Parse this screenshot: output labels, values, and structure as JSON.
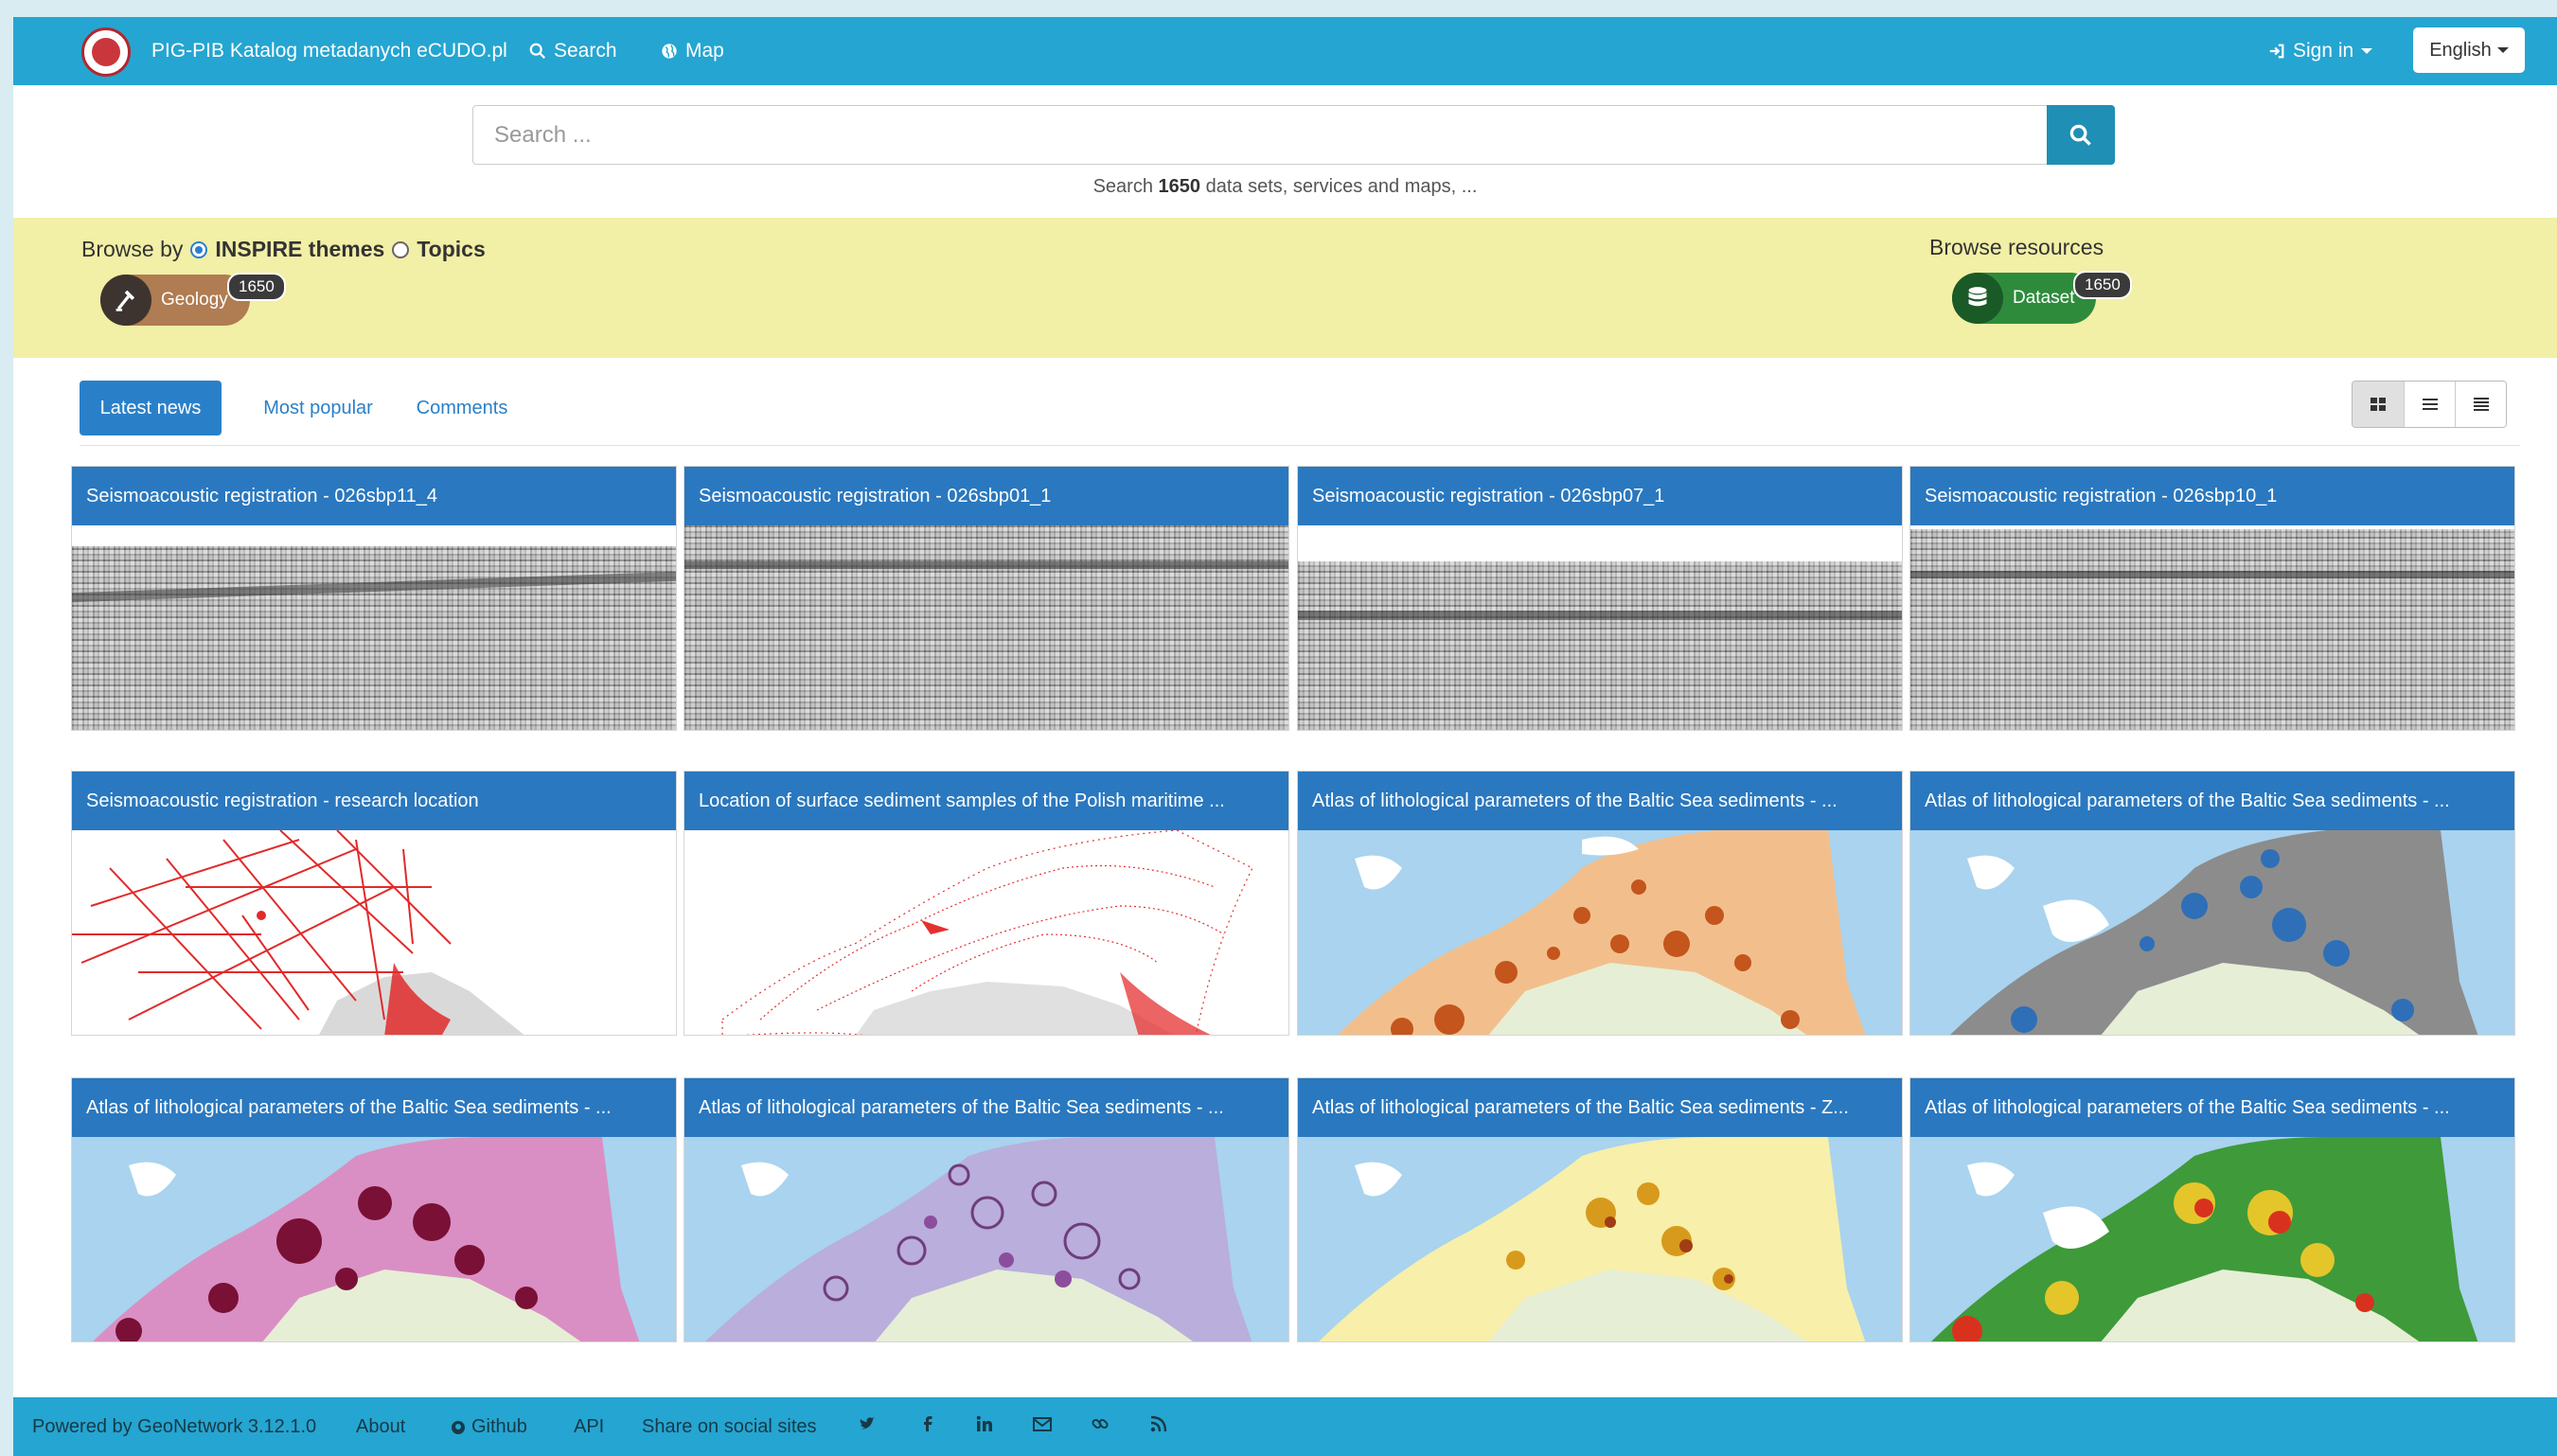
{
  "navbar": {
    "brand": "PIG-PIB Katalog metadanych eCUDO.pl",
    "search": "Search",
    "map": "Map",
    "sign_in": "Sign in",
    "language": "English"
  },
  "search": {
    "placeholder": "Search ...",
    "hint_prefix": "Search",
    "hint_count": "1650",
    "hint_suffix": "data sets, services and maps, ..."
  },
  "browse": {
    "by_label": "Browse by",
    "option_inspire": "INSPIRE themes",
    "option_topics": "Topics",
    "resources_label": "Browse resources",
    "geology_label": "Geology",
    "geology_count": "1650",
    "dataset_label": "Dataset",
    "dataset_count": "1650"
  },
  "tabs": {
    "latest": "Latest news",
    "popular": "Most popular",
    "comments": "Comments"
  },
  "cards": [
    {
      "title": "Seismoacoustic registration - 026sbp11_4",
      "thumb": "seismic"
    },
    {
      "title": "Seismoacoustic registration - 026sbp01_1",
      "thumb": "seismic"
    },
    {
      "title": "Seismoacoustic registration - 026sbp07_1",
      "thumb": "seismic"
    },
    {
      "title": "Seismoacoustic registration - 026sbp10_1",
      "thumb": "seismic"
    },
    {
      "title": "Seismoacoustic registration - research location",
      "thumb": "red-lines"
    },
    {
      "title": "Location of surface sediment samples of the Polish maritime ...",
      "thumb": "red-dots"
    },
    {
      "title": "Atlas of lithological parameters of the Baltic Sea sediments - ...",
      "thumb": "map-orange"
    },
    {
      "title": "Atlas of lithological parameters of the Baltic Sea sediments - ...",
      "thumb": "map-gray"
    },
    {
      "title": "Atlas of lithological parameters of the Baltic Sea sediments - ...",
      "thumb": "map-pink"
    },
    {
      "title": "Atlas of lithological parameters of the Baltic Sea sediments - ...",
      "thumb": "map-lilac"
    },
    {
      "title": "Atlas of lithological parameters of the Baltic Sea sediments - Z...",
      "thumb": "map-yellow"
    },
    {
      "title": "Atlas of lithological parameters of the Baltic Sea sediments - ...",
      "thumb": "map-green"
    }
  ],
  "footer": {
    "powered": "Powered by GeoNetwork 3.12.1.0",
    "about": "About",
    "github": "Github",
    "api": "API",
    "share": "Share on social sites"
  },
  "colors": {
    "navbar": "#25a5d1",
    "browse_band": "#f2efa6",
    "card_title": "#2a78bf",
    "tab_active": "#2a80c8"
  }
}
